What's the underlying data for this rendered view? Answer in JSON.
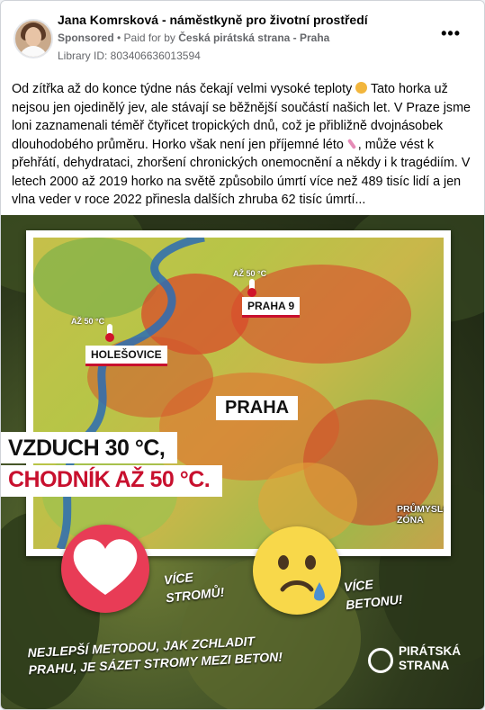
{
  "post": {
    "author": "Jana Komrsková - náměstkyně pro životní prostředí",
    "sponsored": "Sponsored",
    "paid_for_prefix": " • Paid for by ",
    "paid_by": "Česká pirátská strana - Praha",
    "library_id": "Library ID: 803406636013594",
    "more_label": "•••",
    "text_parts": {
      "p1": "Od zítřka až do konce týdne nás čekají velmi vysoké teploty ",
      "p2": " Tato horka už nejsou jen ojedinělý jev, ale stávají se běžnější součástí našich let. V Praze jsme loni zaznamenali téměř čtyřicet tropických dnů, což je přibližně dvojnásobek dlouhodobého průměru. Horko však není jen příjemné léto ",
      "p3": ", může vést k přehřátí, dehydrataci, zhoršení chronických onemocnění a někdy i k tragédiím. V letech 2000 až 2019 horko na světě způsobilo úmrtí více než 489 tisíc lidí a jen vlna veder v roce 2022 přinesla dalších zhruba 62 tisíc úmrtí..."
    },
    "emoji_sun": "sun-emoji",
    "emoji_pink": "popsicle-emoji"
  },
  "ad": {
    "temp_holesovice": "AŽ 50 °C",
    "place_holesovice": "HOLEŠOVICE",
    "temp_praha9": "AŽ 50 °C",
    "place_praha9": "PRAHA 9",
    "city": "PRAHA",
    "zone": "PRŮMYSLOVÁ ZÓNA",
    "air_line": "VZDUCH 30 °C,",
    "sidewalk_line": "CHODNÍK AŽ 50 °C.",
    "more_trees_1": "VÍCE",
    "more_trees_2": "STROMŮ!",
    "more_concrete_1": "VÍCE",
    "more_concrete_2": "BETONU!",
    "bottom_1": "NEJLEPŠÍ METODOU, JAK ZCHLADIT",
    "bottom_2": "PRAHU, JE SÁZET STROMY MEZI BETON!",
    "logo_1": "PIRÁTSKÁ",
    "logo_2": "STRANA",
    "heart_icon": "heart-icon",
    "sad_icon": "sad-face-icon"
  },
  "colors": {
    "red": "#c8102e",
    "heart": "#e83c56",
    "sad": "#f8d84a"
  }
}
